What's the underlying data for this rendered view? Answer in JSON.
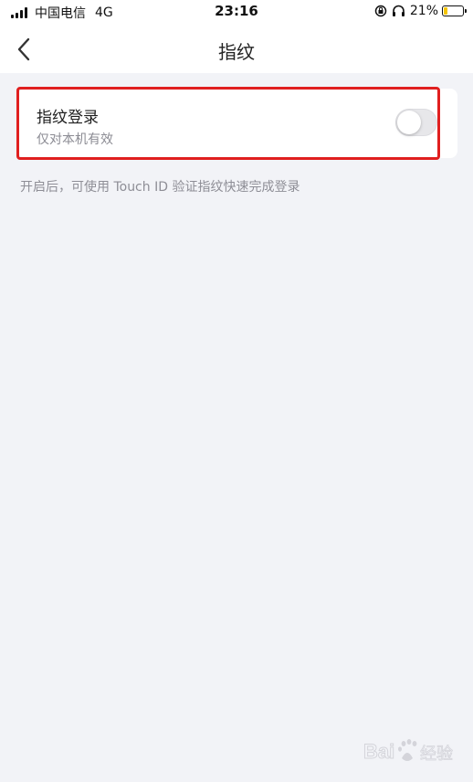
{
  "status_bar": {
    "carrier": "中国电信",
    "network": "4G",
    "time": "23:16",
    "battery_percent_label": "21%",
    "battery_level": 0.21
  },
  "nav": {
    "title": "指纹",
    "back_icon": "chevron-left-icon"
  },
  "setting": {
    "title": "指纹登录",
    "subtitle": "仅对本机有效",
    "enabled": false
  },
  "hint": "开启后，可使用 Touch ID 验证指纹快速完成登录",
  "colors": {
    "background": "#f2f3f7",
    "highlight": "#e01f1f",
    "battery_fill": "#f5c400"
  },
  "watermark": {
    "text": "Bai 经验"
  }
}
